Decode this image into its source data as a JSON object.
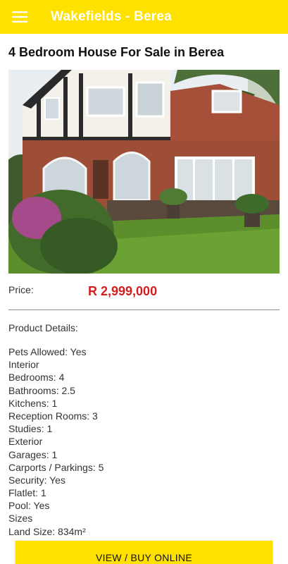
{
  "appbar": {
    "title": "Wakefields - Berea",
    "menu_icon": "hamburger-menu-icon"
  },
  "listing": {
    "title": "4 Bedroom House For Sale in Berea",
    "price_label": "Price:",
    "price": "R 2,999,000",
    "details_heading": "Product Details:",
    "details": [
      "Pets Allowed: Yes",
      "Interior",
      "Bedrooms: 4",
      "Bathrooms: 2.5",
      "Kitchens: 1",
      "Reception Rooms: 3",
      "Studies: 1",
      "Exterior",
      "Garages: 1",
      "Carports / Parkings: 5",
      "Security: Yes",
      "Flatlet: 1",
      "Pool: Yes",
      "Sizes",
      "Land Size: 834m²"
    ]
  },
  "actions": {
    "buy_label": "VIEW / BUY ONLINE"
  },
  "colors": {
    "accent": "#ffe100",
    "price": "#d41e1e",
    "appbar_text": "#ffffff"
  }
}
